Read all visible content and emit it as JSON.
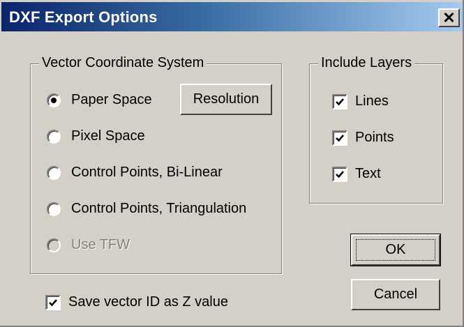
{
  "window": {
    "title": "DXF Export Options",
    "close_glyph": "✕"
  },
  "vector_coordinate_system": {
    "label": "Vector Coordinate System",
    "options": [
      {
        "label": "Paper Space",
        "selected": true,
        "enabled": true
      },
      {
        "label": "Pixel Space",
        "selected": false,
        "enabled": true
      },
      {
        "label": "Control Points, Bi-Linear",
        "selected": false,
        "enabled": true
      },
      {
        "label": "Control Points, Triangulation",
        "selected": false,
        "enabled": true
      },
      {
        "label": "Use TFW",
        "selected": false,
        "enabled": false
      }
    ],
    "resolution_button": "Resolution"
  },
  "include_layers": {
    "label": "Include Layers",
    "items": [
      {
        "label": "Lines",
        "checked": true
      },
      {
        "label": "Points",
        "checked": true
      },
      {
        "label": "Text",
        "checked": true
      }
    ]
  },
  "save_vector_id": {
    "label": "Save vector ID as Z value",
    "checked": true
  },
  "buttons": {
    "ok": "OK",
    "cancel": "Cancel"
  },
  "colors": {
    "title_start": "#0a246a",
    "title_end": "#a6caf0",
    "face": "#d4d0c8"
  }
}
